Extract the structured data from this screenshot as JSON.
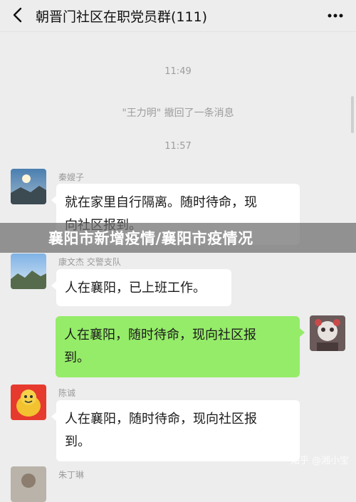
{
  "header": {
    "title": "朝晋门社区在职党员群(111)"
  },
  "messages": {
    "time_1": "11:49",
    "system_recall": "\"王力明\" 撤回了一条消息",
    "time_2": "11:57",
    "m1": {
      "sender": "秦嫂子",
      "text_line1": "就在家里自行隔离。随时待命，现",
      "text_line2": "向社区报到。"
    },
    "m2": {
      "sender": "康文杰  交警支队",
      "text": "人在襄阳，已上班工作。"
    },
    "m3": {
      "text_line1": "人在襄阳，随时待命，现向社区报",
      "text_line2": "到。"
    },
    "m4": {
      "sender": "陈诚",
      "text_line1": "人在襄阳，随时待命，现向社区报",
      "text_line2": "到。"
    },
    "m5": {
      "sender": "朱丁琳"
    }
  },
  "overlay": {
    "headline": "襄阳市新增疫情/襄阳市疫情况"
  },
  "watermark": {
    "text": "知乎 @湘小宝"
  },
  "icons": {
    "back": "chevron-left-icon",
    "more": "more-dots-icon"
  },
  "colors": {
    "background": "#ededed",
    "own_bubble": "#95ec69",
    "other_bubble": "#ffffff"
  }
}
